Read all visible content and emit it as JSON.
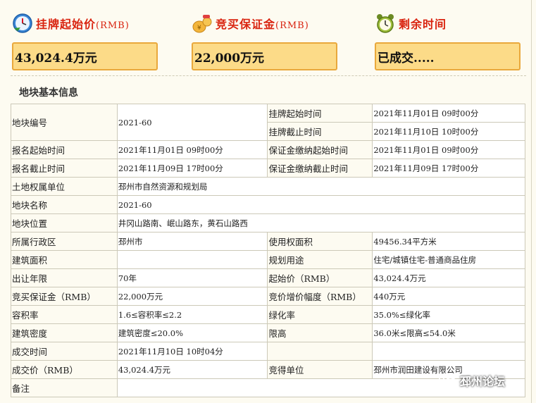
{
  "summary": {
    "start_price_label": "挂牌起始价",
    "start_price_unit": "(RMB)",
    "start_price_value": "43,024.4万元",
    "deposit_label": "竞买保证金",
    "deposit_unit": "(RMB)",
    "deposit_value": "22,000万元",
    "remaining_label": "剩余时间",
    "remaining_value": "已成交....."
  },
  "section_title": "地块基本信息",
  "table": {
    "r1": {
      "l1": "地块编号",
      "v1": "2021-60",
      "l2a": "挂牌起始时间",
      "v2a": "2021年11月01日 09时00分",
      "l2b": "挂牌截止时间",
      "v2b": "2021年11月10日 10时00分"
    },
    "r2": {
      "l1": "报名起始时间",
      "v1": "2021年11月01日 09时00分",
      "l2": "保证金缴纳起始时间",
      "v2": "2021年11月01日 09时00分"
    },
    "r3": {
      "l1": "报名截止时间",
      "v1": "2021年11月09日 17时00分",
      "l2": "保证金缴纳截止时间",
      "v2": "2021年11月09日 17时00分"
    },
    "r4": {
      "l1": "土地权属单位",
      "v1": "邳州市自然资源和规划局"
    },
    "r5": {
      "l1": "地块名称",
      "v1": "2021-60"
    },
    "r6": {
      "l1": "地块位置",
      "v1": "井冈山路南、岷山路东，黄石山路西"
    },
    "r7": {
      "l1": "所属行政区",
      "v1": "邳州市",
      "l2": "使用权面积",
      "v2": "49456.34平方米"
    },
    "r8": {
      "l1": "建筑面积",
      "v1": "",
      "l2": "规划用途",
      "v2": "住宅/城镇住宅-普通商品住房"
    },
    "r9": {
      "l1": "出让年限",
      "v1": "70年",
      "l2": "起始价（RMB）",
      "v2": "43,024.4万元"
    },
    "r10": {
      "l1": "竞买保证金（RMB）",
      "v1": "22,000万元",
      "l2": "竞价增价幅度（RMB）",
      "v2": "440万元"
    },
    "r11": {
      "l1": "容积率",
      "v1": "1.6≤容积率≤2.2",
      "l2": "绿化率",
      "v2": "35.0%≤绿化率"
    },
    "r12": {
      "l1": "建筑密度",
      "v1": "建筑密度≤20.0%",
      "l2": "限高",
      "v2": "36.0米≤限高≤54.0米"
    },
    "r13": {
      "l1": "成交时间",
      "v1": "2021年11月10日 10时04分",
      "l2": "",
      "v2": ""
    },
    "r14": {
      "l1": "成交价（RMB）",
      "v1": "43,024.4万元",
      "l2": "竞得单位",
      "v2": "邳州市润田建设有限公司"
    },
    "r15": {
      "l1": "备注",
      "v1": ""
    }
  },
  "watermark": "邳州论坛",
  "icons": {
    "start_price": "clock-icon",
    "deposit": "money-bag-icon",
    "remaining": "alarm-clock-icon",
    "watermark": "wechat-icon"
  },
  "colors": {
    "title_red": "#d9230f",
    "box_fill": "#fcdb88",
    "box_border": "#e9a83c",
    "page_bg": "#fdfbf1"
  }
}
